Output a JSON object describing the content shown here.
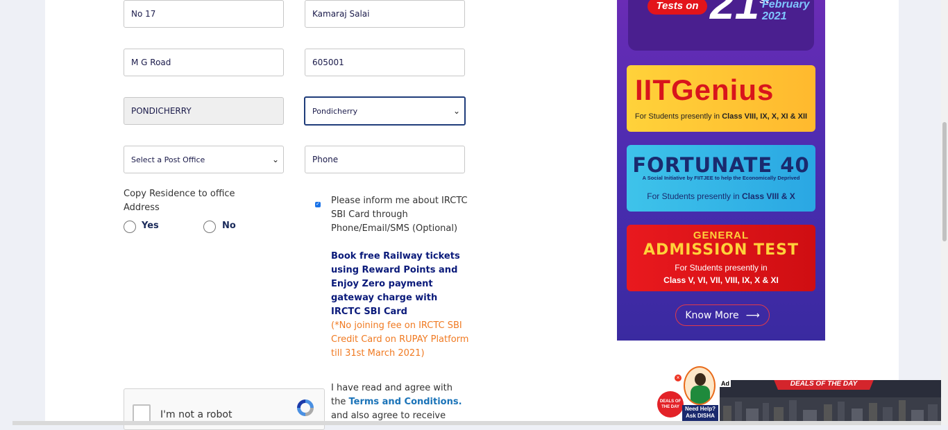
{
  "form": {
    "address_line1": "No 17",
    "street": "Kamaraj Salai",
    "area": "M G Road",
    "pincode": "605001",
    "city": "PONDICHERRY",
    "state_select": "Pondicherry",
    "post_office_select": "Select a Post Office",
    "phone_placeholder": "Phone",
    "copy_residence_label": "Copy Residence to office Address",
    "radio_yes": "Yes",
    "radio_no": "No",
    "sbi_optin": "Please inform me about IRCTC SBI Card through Phone/Email/SMS (Optional)",
    "sbi_promo": "Book free Railway tickets using Reward Points and Enjoy Zero payment gateway charge with IRCTC SBI Card",
    "sbi_note": "(*No joining fee on IRCTC SBI Credit Card on RUPAY Platform till 31st March 2021)",
    "terms_prefix": "I have read and agree with the",
    "terms_link": "Terms and Conditions.",
    "terms_suffix": "and also agree to receive"
  },
  "recaptcha": {
    "label": "I'm not a robot"
  },
  "ad": {
    "tests_on": "Tests on",
    "date_number": "21",
    "date_suffix": "st",
    "month": "February",
    "year": "2021",
    "card1_title": "IITGenius",
    "card1_sub_prefix": "For Students presently in",
    "card1_sub_classes": "Class VIII, IX, X, XI & XII",
    "card2_title": "FORTUNATE 40",
    "card2_tagline": "A Social Initiative by FIITJEE to help the Economically Deprived",
    "card2_sub_prefix": "For Students presently in",
    "card2_sub_classes": "Class VIII & X",
    "card3_general": "GENERAL",
    "card3_title": "ADMISSION TEST",
    "card3_sub1": "For Students presently in",
    "card3_sub2": "Class V, VI, VII, VIII, IX, X & XI",
    "know_more": "Know More"
  },
  "disha": {
    "help_line1": "Need Help?",
    "help_line2": "Ask DISHA",
    "deals_badge": "DEALS OF THE DAY"
  },
  "bottom_ad": {
    "badge": "Ad",
    "banner": "DEALS OF THE DAY"
  },
  "colors": {
    "navy": "#0a1a7a",
    "orange": "#f07a22",
    "link": "#1a73b8"
  }
}
